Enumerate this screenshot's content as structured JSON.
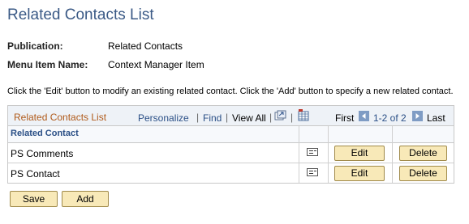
{
  "page": {
    "title": "Related Contacts List"
  },
  "fields": [
    {
      "label": "Publication:",
      "value": "Related Contacts"
    },
    {
      "label": "Menu Item Name:",
      "value": "Context Manager Item"
    }
  ],
  "instructions": "Click the 'Edit' button to modify an existing related contact. Click the 'Add' button to specify a new related contact.",
  "grid": {
    "title": "Related Contacts List",
    "personalize": "Personalize",
    "find": "Find",
    "view_all": "View All",
    "first": "First",
    "range": "1-2 of 2",
    "last": "Last",
    "column_header": "Related Contact",
    "rows": [
      {
        "label": "PS Comments",
        "edit": "Edit",
        "delete": "Delete"
      },
      {
        "label": "PS Contact",
        "edit": "Edit",
        "delete": "Delete"
      }
    ]
  },
  "footer": {
    "save": "Save",
    "add": "Add"
  },
  "icons": {
    "view_options": "zoom-grid-icon",
    "download": "download-excel-icon",
    "prev": "prev-arrow-icon",
    "next": "next-arrow-icon",
    "detail": "detail-view-icon"
  },
  "colors": {
    "title": "#3b5a86",
    "grid_title": "#b05a1a",
    "link": "#2a4f86",
    "button_bg": "#f8e9b8"
  }
}
